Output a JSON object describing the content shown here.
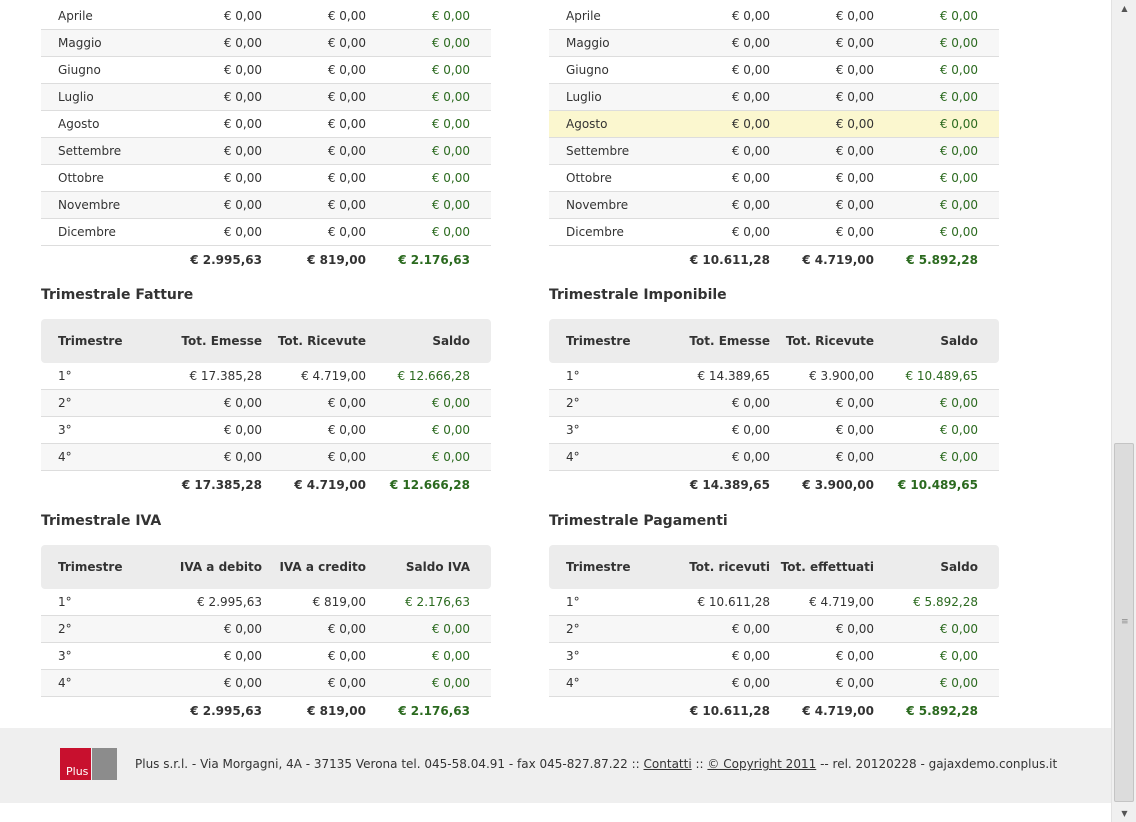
{
  "monthly": {
    "left": {
      "rows": [
        {
          "m": "Aprile",
          "a": "€ 0,00",
          "b": "€ 0,00",
          "c": "€ 0,00"
        },
        {
          "m": "Maggio",
          "a": "€ 0,00",
          "b": "€ 0,00",
          "c": "€ 0,00"
        },
        {
          "m": "Giugno",
          "a": "€ 0,00",
          "b": "€ 0,00",
          "c": "€ 0,00"
        },
        {
          "m": "Luglio",
          "a": "€ 0,00",
          "b": "€ 0,00",
          "c": "€ 0,00"
        },
        {
          "m": "Agosto",
          "a": "€ 0,00",
          "b": "€ 0,00",
          "c": "€ 0,00"
        },
        {
          "m": "Settembre",
          "a": "€ 0,00",
          "b": "€ 0,00",
          "c": "€ 0,00"
        },
        {
          "m": "Ottobre",
          "a": "€ 0,00",
          "b": "€ 0,00",
          "c": "€ 0,00"
        },
        {
          "m": "Novembre",
          "a": "€ 0,00",
          "b": "€ 0,00",
          "c": "€ 0,00"
        },
        {
          "m": "Dicembre",
          "a": "€ 0,00",
          "b": "€ 0,00",
          "c": "€ 0,00"
        }
      ],
      "total": {
        "a": "€ 2.995,63",
        "b": "€ 819,00",
        "c": "€ 2.176,63"
      }
    },
    "right": {
      "rows": [
        {
          "m": "Aprile",
          "a": "€ 0,00",
          "b": "€ 0,00",
          "c": "€ 0,00"
        },
        {
          "m": "Maggio",
          "a": "€ 0,00",
          "b": "€ 0,00",
          "c": "€ 0,00"
        },
        {
          "m": "Giugno",
          "a": "€ 0,00",
          "b": "€ 0,00",
          "c": "€ 0,00"
        },
        {
          "m": "Luglio",
          "a": "€ 0,00",
          "b": "€ 0,00",
          "c": "€ 0,00"
        },
        {
          "m": "Agosto",
          "a": "€ 0,00",
          "b": "€ 0,00",
          "c": "€ 0,00"
        },
        {
          "m": "Settembre",
          "a": "€ 0,00",
          "b": "€ 0,00",
          "c": "€ 0,00"
        },
        {
          "m": "Ottobre",
          "a": "€ 0,00",
          "b": "€ 0,00",
          "c": "€ 0,00"
        },
        {
          "m": "Novembre",
          "a": "€ 0,00",
          "b": "€ 0,00",
          "c": "€ 0,00"
        },
        {
          "m": "Dicembre",
          "a": "€ 0,00",
          "b": "€ 0,00",
          "c": "€ 0,00"
        }
      ],
      "total": {
        "a": "€ 10.611,28",
        "b": "€ 4.719,00",
        "c": "€ 5.892,28"
      }
    }
  },
  "trim_fatture": {
    "title": "Trimestrale Fatture",
    "headers": [
      "Trimestre",
      "Tot. Emesse",
      "Tot. Ricevute",
      "Saldo"
    ],
    "rows": [
      {
        "m": "1°",
        "a": "€ 17.385,28",
        "b": "€ 4.719,00",
        "c": "€ 12.666,28"
      },
      {
        "m": "2°",
        "a": "€ 0,00",
        "b": "€ 0,00",
        "c": "€ 0,00"
      },
      {
        "m": "3°",
        "a": "€ 0,00",
        "b": "€ 0,00",
        "c": "€ 0,00"
      },
      {
        "m": "4°",
        "a": "€ 0,00",
        "b": "€ 0,00",
        "c": "€ 0,00"
      }
    ],
    "total": {
      "a": "€ 17.385,28",
      "b": "€ 4.719,00",
      "c": "€ 12.666,28"
    }
  },
  "trim_imponibile": {
    "title": "Trimestrale Imponibile",
    "headers": [
      "Trimestre",
      "Tot. Emesse",
      "Tot. Ricevute",
      "Saldo"
    ],
    "rows": [
      {
        "m": "1°",
        "a": "€ 14.389,65",
        "b": "€ 3.900,00",
        "c": "€ 10.489,65"
      },
      {
        "m": "2°",
        "a": "€ 0,00",
        "b": "€ 0,00",
        "c": "€ 0,00"
      },
      {
        "m": "3°",
        "a": "€ 0,00",
        "b": "€ 0,00",
        "c": "€ 0,00"
      },
      {
        "m": "4°",
        "a": "€ 0,00",
        "b": "€ 0,00",
        "c": "€ 0,00"
      }
    ],
    "total": {
      "a": "€ 14.389,65",
      "b": "€ 3.900,00",
      "c": "€ 10.489,65"
    }
  },
  "trim_iva": {
    "title": "Trimestrale IVA",
    "headers": [
      "Trimestre",
      "IVA a debito",
      "IVA a credito",
      "Saldo IVA"
    ],
    "rows": [
      {
        "m": "1°",
        "a": "€ 2.995,63",
        "b": "€ 819,00",
        "c": "€ 2.176,63"
      },
      {
        "m": "2°",
        "a": "€ 0,00",
        "b": "€ 0,00",
        "c": "€ 0,00"
      },
      {
        "m": "3°",
        "a": "€ 0,00",
        "b": "€ 0,00",
        "c": "€ 0,00"
      },
      {
        "m": "4°",
        "a": "€ 0,00",
        "b": "€ 0,00",
        "c": "€ 0,00"
      }
    ],
    "total": {
      "a": "€ 2.995,63",
      "b": "€ 819,00",
      "c": "€ 2.176,63"
    }
  },
  "trim_pagamenti": {
    "title": "Trimestrale Pagamenti",
    "headers": [
      "Trimestre",
      "Tot. ricevuti",
      "Tot. effettuati",
      "Saldo"
    ],
    "rows": [
      {
        "m": "1°",
        "a": "€ 10.611,28",
        "b": "€ 4.719,00",
        "c": "€ 5.892,28"
      },
      {
        "m": "2°",
        "a": "€ 0,00",
        "b": "€ 0,00",
        "c": "€ 0,00"
      },
      {
        "m": "3°",
        "a": "€ 0,00",
        "b": "€ 0,00",
        "c": "€ 0,00"
      },
      {
        "m": "4°",
        "a": "€ 0,00",
        "b": "€ 0,00",
        "c": "€ 0,00"
      }
    ],
    "total": {
      "a": "€ 10.611,28",
      "b": "€ 4.719,00",
      "c": "€ 5.892,28"
    }
  },
  "footer": {
    "logo_text": "Plus",
    "address": "Plus s.r.l. - Via Morgagni, 4A - 37135 Verona tel. 045-58.04.91 - fax 045-827.87.22 ::",
    "contatti": "Contatti",
    "sep": "::",
    "copyright": "© Copyright 2011",
    "release": "-- rel. 20120228 - gajaxdemo.conplus.it"
  },
  "colors": {
    "positive": "#2b6a1f",
    "highlight": "#fbf7cf",
    "logo_red": "#c8102e"
  }
}
